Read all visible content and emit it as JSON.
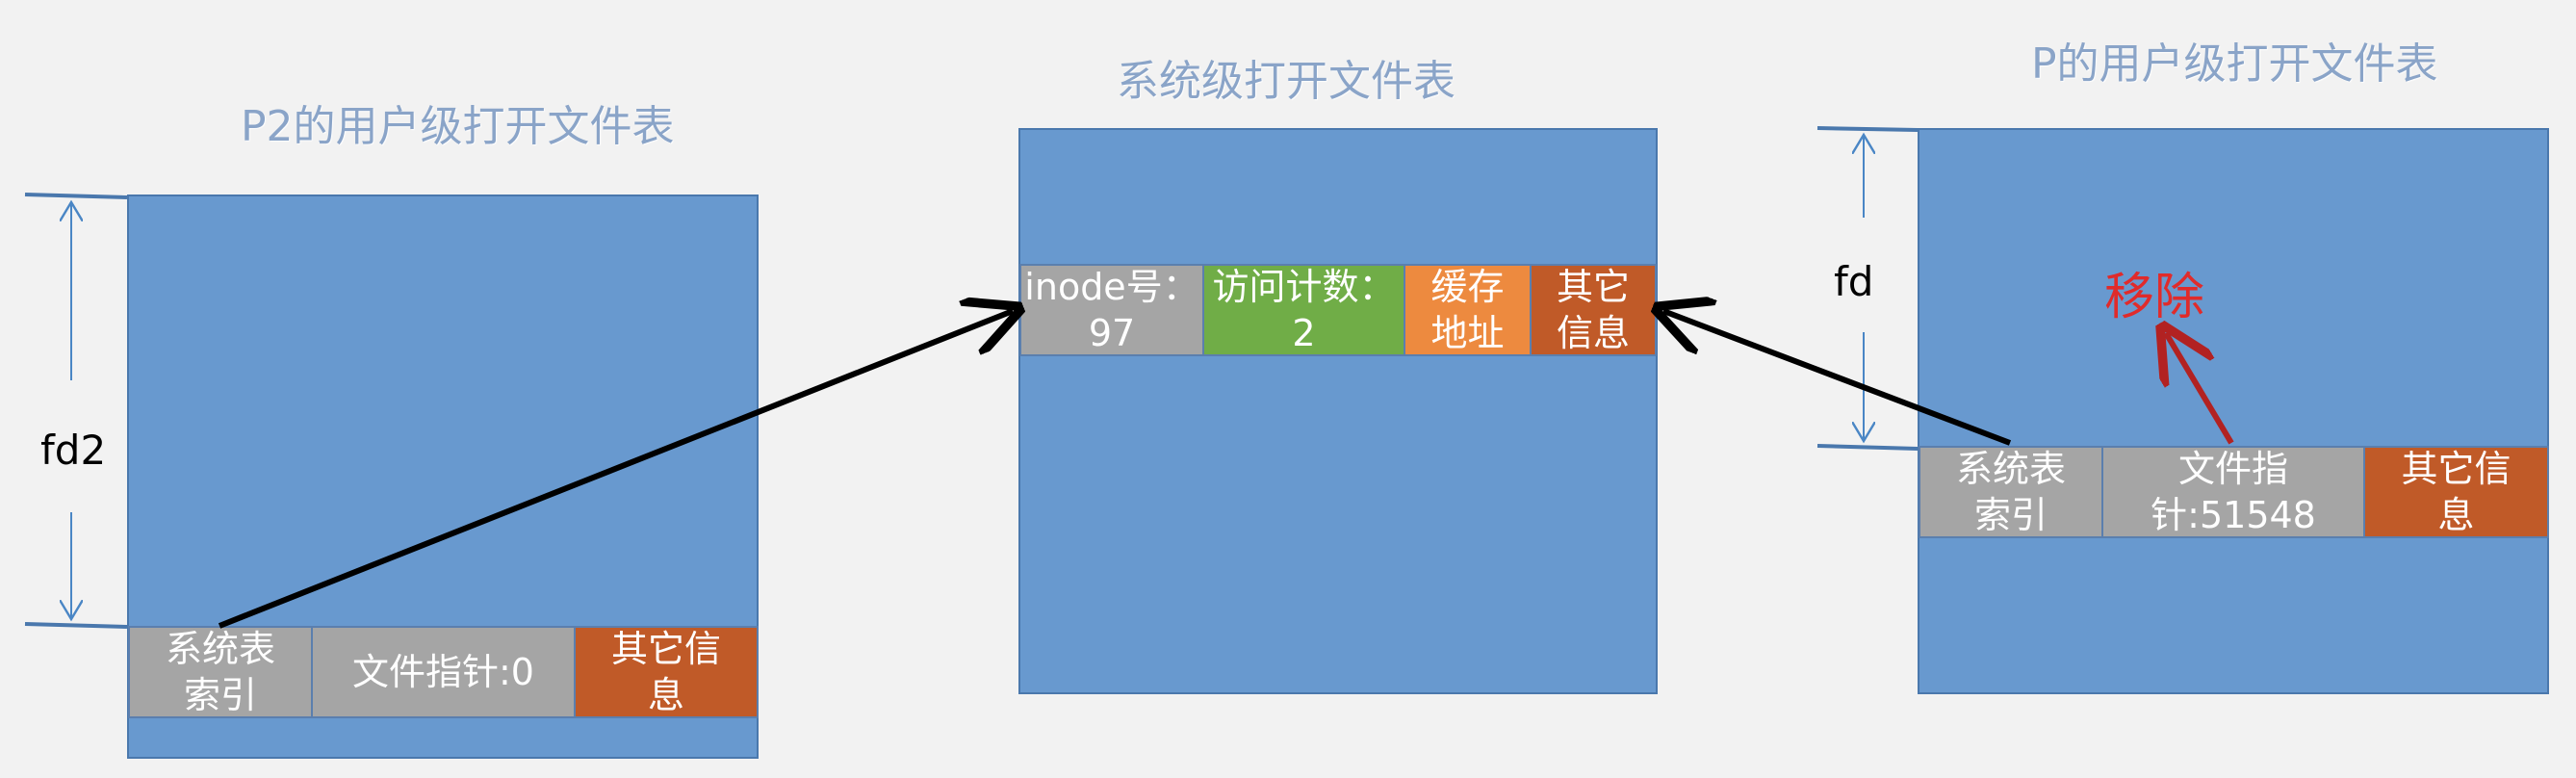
{
  "titles": {
    "p2_table": "P2的用户级打开文件表",
    "system_table": "系统级打开文件表",
    "p_table": "P的用户级打开文件表"
  },
  "p2_entry": {
    "index": "系统表\n索引",
    "pointer": "文件指针:0",
    "other": "其它信\n息"
  },
  "system_entry": {
    "inode": "inode号：\n97",
    "count": "访问计数：\n2",
    "cache": "缓存\n地址",
    "other": "其它\n信息"
  },
  "p_entry": {
    "index": "系统表\n索引",
    "pointer": "文件指\n针:51548",
    "other": "其它信\n息"
  },
  "labels": {
    "fd2": "fd2",
    "fd": "fd",
    "remove": "移除"
  },
  "colors": {
    "table_fill": "#6899cf",
    "gray_cell": "#a5a5a5",
    "green_cell": "#70ad47",
    "orange_cell": "#ed8a3f",
    "rust_cell": "#c05a28",
    "remove": "#e02b2b",
    "remove_arrow": "#b22222",
    "title": "#8aa4c8"
  }
}
